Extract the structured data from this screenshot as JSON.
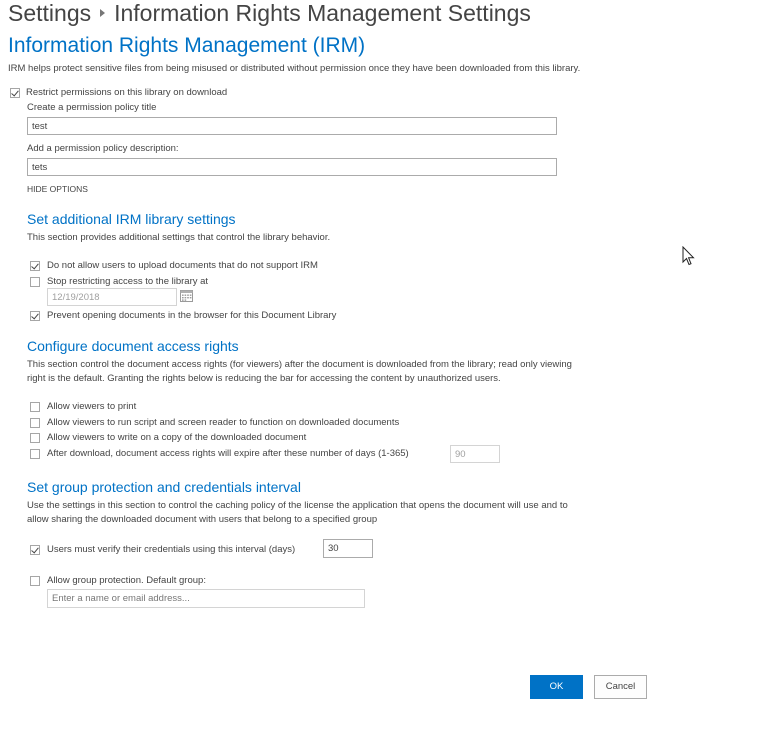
{
  "breadcrumb": {
    "root": "Settings",
    "current": "Information Rights Management Settings"
  },
  "page_title": "Information Rights Management (IRM)",
  "intro": "IRM helps protect sensitive files from being misused or distributed without permission once they have been downloaded from this library.",
  "restrict": {
    "label": "Restrict permissions on this library on download",
    "checked": true,
    "policy_title_label": "Create a permission policy title",
    "policy_title_value": "test",
    "policy_desc_label": "Add a permission policy description:",
    "policy_desc_value": "tets",
    "hide_options": "HIDE OPTIONS"
  },
  "library_settings": {
    "title": "Set additional IRM library settings",
    "description": "This section provides additional settings that control the library behavior.",
    "upload_label": "Do not allow users to upload documents that do not support IRM",
    "stop_label": "Stop restricting access to the library at",
    "stop_date": "12/19/2018",
    "prevent_label": "Prevent opening documents in the browser for this Document Library"
  },
  "access_rights": {
    "title": "Configure document access rights",
    "description_line1": "This section control the document access rights (for viewers) after the document is downloaded from the library; read only viewing",
    "description_line2": "right is the default. Granting the rights below is reducing the bar for accessing the content by unauthorized users.",
    "print_label": "Allow viewers to print",
    "script_label": "Allow viewers to run script and screen reader to function on downloaded documents",
    "write_label": "Allow viewers to write on a copy of the downloaded document",
    "expire_label": "After download, document access rights will expire after these number of days (1-365)",
    "expire_days": "90"
  },
  "group_protection": {
    "title": "Set group protection and credentials interval",
    "description_line1": "Use the settings in this section to control the caching policy of the license the application that opens the document will use and to",
    "description_line2": "allow sharing the downloaded document with users that belong to a specified group",
    "verify_label": "Users must verify their credentials using this interval (days)",
    "verify_days": "30",
    "group_label": "Allow group protection. Default group:",
    "group_placeholder": "Enter a name or email address..."
  },
  "buttons": {
    "ok": "OK",
    "cancel": "Cancel"
  },
  "colors": {
    "accent": "#0072c6",
    "text": "#444444"
  }
}
